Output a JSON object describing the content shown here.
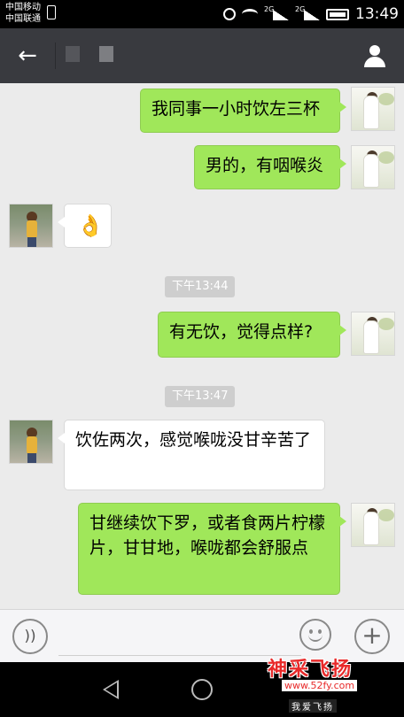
{
  "status_bar": {
    "carrier_1": "中国移动",
    "carrier_2": "中国联通",
    "network_1": "2G",
    "network_2": "2G",
    "time": "13:49"
  },
  "nav": {
    "back_icon": "←",
    "profile_icon": "person-icon"
  },
  "messages": [
    {
      "side": "out",
      "text": "我同事一小时饮左三杯"
    },
    {
      "side": "out",
      "text": "男的，有咽喉炎"
    },
    {
      "side": "in",
      "sticker": "ok-hand"
    },
    {
      "type": "time",
      "text": "下午13:44"
    },
    {
      "side": "out",
      "text": "有无饮，觉得点样?"
    },
    {
      "type": "time",
      "text": "下午13:47"
    },
    {
      "side": "in",
      "text": "饮佐两次，感觉喉咙没甘辛苦了"
    },
    {
      "side": "out",
      "text": "甘继续饮下罗，或者食两片柠檬片，甘甘地，喉咙都会舒服点"
    }
  ],
  "input_bar": {
    "voice_icon": "voice-icon",
    "emoji_icon": "emoji-icon",
    "plus_label": "+"
  },
  "watermark": {
    "title": "神采飞扬",
    "url": "www.52fy.com",
    "subtitle": "我爱飞扬"
  },
  "colors": {
    "nav_bg": "#393a3f",
    "outgoing_bubble": "#a0e75a",
    "chat_bg": "#ebebeb"
  }
}
